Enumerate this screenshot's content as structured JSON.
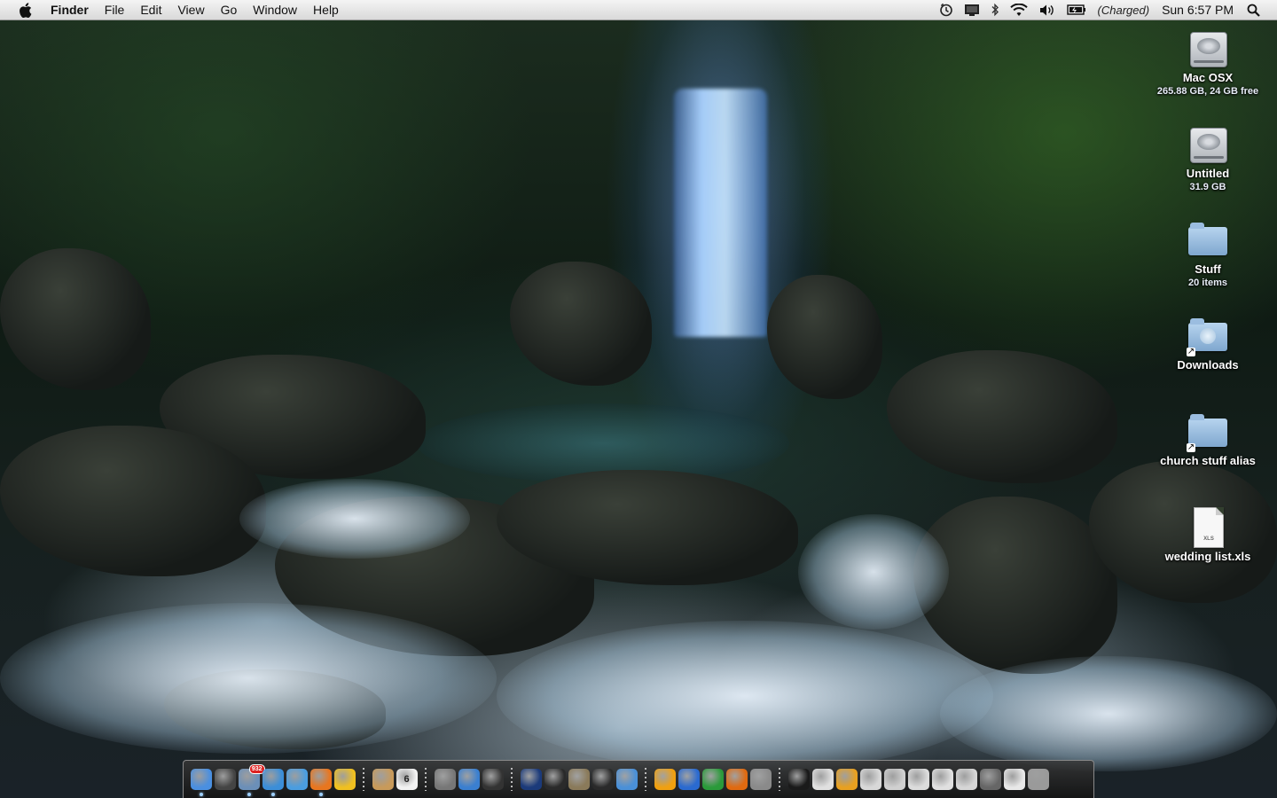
{
  "menubar": {
    "app_name": "Finder",
    "menus": [
      "File",
      "Edit",
      "View",
      "Go",
      "Window",
      "Help"
    ],
    "status_icons": [
      "time-machine-icon",
      "display-icon",
      "bluetooth-icon",
      "wifi-icon",
      "volume-icon",
      "battery-icon"
    ],
    "battery_status": "(Charged)",
    "clock": "Sun 6:57 PM"
  },
  "desktop": {
    "icons": [
      {
        "name": "Mac OSX",
        "sub": "265.88 GB, 24 GB free",
        "kind": "hard-drive"
      },
      {
        "name": "Untitled",
        "sub": "31.9 GB",
        "kind": "hard-drive"
      },
      {
        "name": "Stuff",
        "sub": "20 items",
        "kind": "folder"
      },
      {
        "name": "Downloads",
        "sub": "",
        "kind": "downloads-folder-alias"
      },
      {
        "name": "church stuff alias",
        "sub": "",
        "kind": "folder-alias"
      },
      {
        "name": "wedding list.xls",
        "sub": "",
        "kind": "spreadsheet-document",
        "ext": "XLS"
      }
    ]
  },
  "dock": {
    "mail_badge": "932",
    "calendar_day": "6",
    "groups": [
      [
        {
          "icon": "finder-icon",
          "color": "#4a8fe0",
          "running": true
        },
        {
          "icon": "dashboard-icon",
          "color": "#444444",
          "running": false
        },
        {
          "icon": "mail-icon",
          "color": "#6b8fb8",
          "running": true
        },
        {
          "icon": "safari-icon",
          "color": "#3b8ed8",
          "running": true
        },
        {
          "icon": "ichat-icon",
          "color": "#4a9de0",
          "running": false
        },
        {
          "icon": "firefox-icon",
          "color": "#e8761f",
          "running": true
        },
        {
          "icon": "adium-icon",
          "color": "#f0c020",
          "running": false
        }
      ],
      [
        {
          "icon": "address-book-icon",
          "color": "#c89a5a",
          "running": false
        },
        {
          "icon": "ical-icon",
          "color": "#f2f2f2",
          "running": false
        }
      ],
      [
        {
          "icon": "camera-icon",
          "color": "#777777",
          "running": false
        },
        {
          "icon": "itunes-icon",
          "color": "#3a7fd0",
          "running": false
        },
        {
          "icon": "imovie-icon",
          "color": "#333333",
          "running": false
        }
      ],
      [
        {
          "icon": "photoshop-icon",
          "color": "#1b3a7a",
          "running": false
        },
        {
          "icon": "aperture-icon",
          "color": "#2a2a2a",
          "running": false
        },
        {
          "icon": "iphoto-icon",
          "color": "#8a7a5a",
          "running": false
        },
        {
          "icon": "final-cut-icon",
          "color": "#2a2a2a",
          "running": false
        },
        {
          "icon": "dvd-player-icon",
          "color": "#4a90d8",
          "running": false
        }
      ],
      [
        {
          "icon": "office-icon",
          "color": "#f0a010",
          "running": false
        },
        {
          "icon": "word-icon",
          "color": "#2a6ad0",
          "running": false
        },
        {
          "icon": "excel-icon",
          "color": "#2a9a3a",
          "running": false
        },
        {
          "icon": "powerpoint-icon",
          "color": "#e06a10",
          "running": false
        },
        {
          "icon": "system-preferences-icon",
          "color": "#8a8a8a",
          "running": false
        }
      ],
      [
        {
          "icon": "activity-monitor-icon",
          "color": "#1a1a1a",
          "running": false
        },
        {
          "icon": "stack-icon",
          "color": "#e0e0e0",
          "running": false
        },
        {
          "icon": "utility-icon",
          "color": "#e8a020",
          "running": false
        },
        {
          "icon": "minimized-window-icon",
          "color": "#d8d8d8",
          "running": false
        },
        {
          "icon": "minimized-window-icon",
          "color": "#d0d0d0",
          "running": false
        },
        {
          "icon": "minimized-window-icon",
          "color": "#dcdcdc",
          "running": false
        },
        {
          "icon": "minimized-window-icon",
          "color": "#e0e0e0",
          "running": false
        },
        {
          "icon": "minimized-window-icon",
          "color": "#d6d6d6",
          "running": false
        },
        {
          "icon": "minimized-window-icon",
          "color": "#666666",
          "running": false
        },
        {
          "icon": "documents-stack-icon",
          "color": "#e8e8e8",
          "running": false
        },
        {
          "icon": "trash-icon",
          "color": "#9a9a9a",
          "running": false
        }
      ]
    ]
  }
}
